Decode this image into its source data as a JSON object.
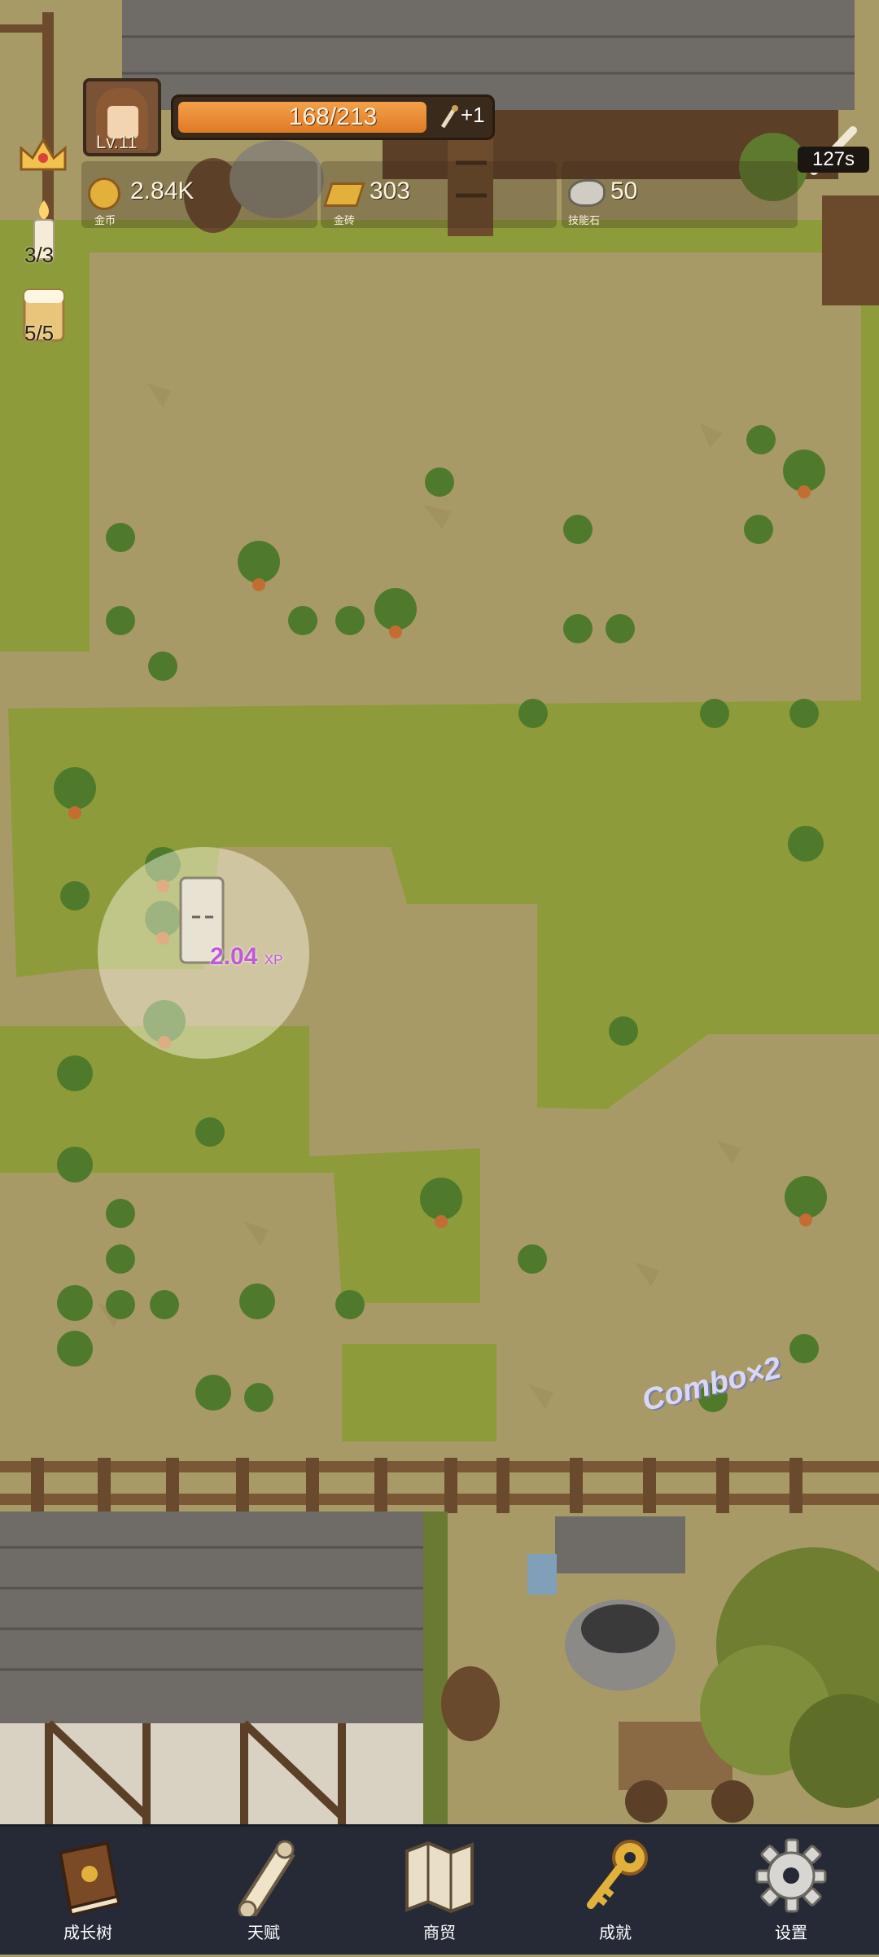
{
  "player": {
    "level": "Lv.11"
  },
  "xp": {
    "current_max": "168/213",
    "plus": "+1",
    "fill": 0.79
  },
  "resources": {
    "gold": {
      "value": "2.84K",
      "label": "金币",
      "icon": "gold-coin-icon"
    },
    "gold_bar": {
      "value": "303",
      "label": "金砖",
      "icon": "gold-bar-icon"
    },
    "skill_stone": {
      "value": "50",
      "label": "技能石",
      "icon": "skill-stone-icon"
    }
  },
  "side": {
    "candle_count": "3/3",
    "beer_count": "5/5"
  },
  "timer": "127s",
  "floating": {
    "xp_amount": "2.04",
    "xp_unit": "XP",
    "combo": "Combo×2"
  },
  "nav": [
    {
      "label": "成长树",
      "icon": "book-icon"
    },
    {
      "label": "天赋",
      "icon": "scroll-icon"
    },
    {
      "label": "商贸",
      "icon": "map-icon"
    },
    {
      "label": "成就",
      "icon": "key-icon"
    },
    {
      "label": "设置",
      "icon": "gear-icon"
    }
  ],
  "colors": {
    "grass": "#8d9b3a",
    "dirt": "#a89a66",
    "nav_bg": "#252a36",
    "xp_fill": "#e98a33",
    "xp_text": "#c05ad6"
  }
}
